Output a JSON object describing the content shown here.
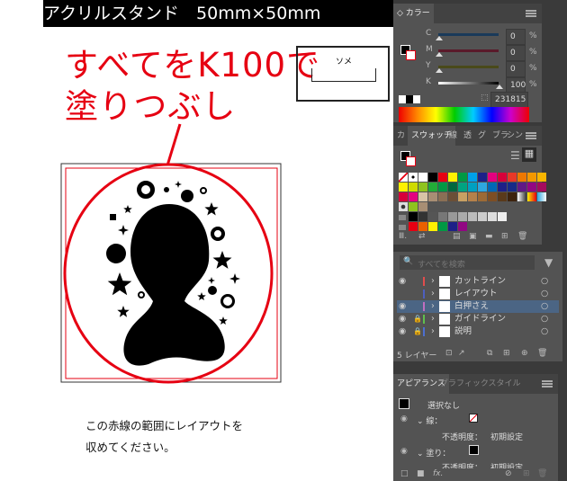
{
  "artboard": {
    "title": "アクリルスタンド　50mm×50mm",
    "instruction_line1": "すべてをK100で",
    "instruction_line2": "塗りつぶし",
    "partial_label": "ソメ",
    "note_line1": "この赤線の範囲にレイアウトを",
    "note_line2": "収めてください。",
    "accent_red": "#e60012"
  },
  "color_panel": {
    "tab": "カラー",
    "channels": [
      {
        "label": "C",
        "value": "0",
        "unit": "%"
      },
      {
        "label": "M",
        "value": "0",
        "unit": "%"
      },
      {
        "label": "Y",
        "value": "0",
        "unit": "%"
      },
      {
        "label": "K",
        "value": "100",
        "unit": "%"
      }
    ],
    "hex": "231815"
  },
  "swatches_panel": {
    "tabs": [
      "カ",
      "スウォッチ",
      "線",
      "透",
      "グ",
      "ブラ",
      "シン"
    ],
    "active_tab": "スウォッチ",
    "rows": [
      [
        "none",
        "reg",
        "#ffffff",
        "#000000",
        "#e60012",
        "#fff100",
        "#009944",
        "#00a0e9",
        "#1d2088",
        "#e4007f",
        "#d7003a",
        "#e83828",
        "#ee7800",
        "#f39800",
        "#f8b500"
      ],
      [
        "#fff100",
        "#cfdb00",
        "#8fc31f",
        "#22ac38",
        "#009944",
        "#00693e",
        "#00a381",
        "#00a0c1",
        "#2ea7e0",
        "#0068b7",
        "#1d2088",
        "#172a88",
        "#601986",
        "#920783",
        "#a40b5d"
      ],
      [
        "#d7003a",
        "#e4007f",
        "#d8c3a5",
        "#a88e74",
        "#8a6f55",
        "#6b4f37",
        "#c8a063",
        "#b5814b",
        "#9c6a36",
        "#7d4e24",
        "#5a3a1b",
        "#3d230e",
        "grad-gray",
        "grad-orange",
        "grad-blue"
      ],
      [
        "pattern1",
        "pattern2",
        "pattern3"
      ],
      [
        "folder",
        "#000000",
        "#333333",
        "#555555",
        "#777777",
        "#999999",
        "#aaaaaa",
        "#bbbbbb",
        "#cccccc",
        "#dddddd",
        "#eeeeee"
      ],
      [
        "folder",
        "#e60012",
        "#eb6100",
        "#fff100",
        "#009944",
        "#1d2088",
        "#920783"
      ]
    ]
  },
  "layers_panel": {
    "search_placeholder": "すべてを検索",
    "layers": [
      {
        "name": "カットライン",
        "color": "#e14d4d",
        "visible": true,
        "locked": false,
        "selected": false
      },
      {
        "name": "レイアウト",
        "color": "#4d5fbf",
        "visible": false,
        "locked": false,
        "selected": false
      },
      {
        "name": "白押さえ",
        "color": "#c06fc0",
        "visible": true,
        "locked": false,
        "selected": true
      },
      {
        "name": "ガイドライン",
        "color": "#5fbf4d",
        "visible": true,
        "locked": true,
        "selected": false
      },
      {
        "name": "説明",
        "color": "#4d6fd0",
        "visible": true,
        "locked": true,
        "selected": false
      }
    ],
    "count_label": "5 レイヤー"
  },
  "appearance_panel": {
    "tabs": [
      "アピアランス",
      "グラフィックスタイル"
    ],
    "selection": "選択なし",
    "stroke_label": "線：",
    "opacity_label": "不透明度：",
    "opacity_value": "初期設定",
    "fill_label": "塗り：",
    "opacity2_label": "不透明度：",
    "opacity2_value": "初期設定"
  }
}
